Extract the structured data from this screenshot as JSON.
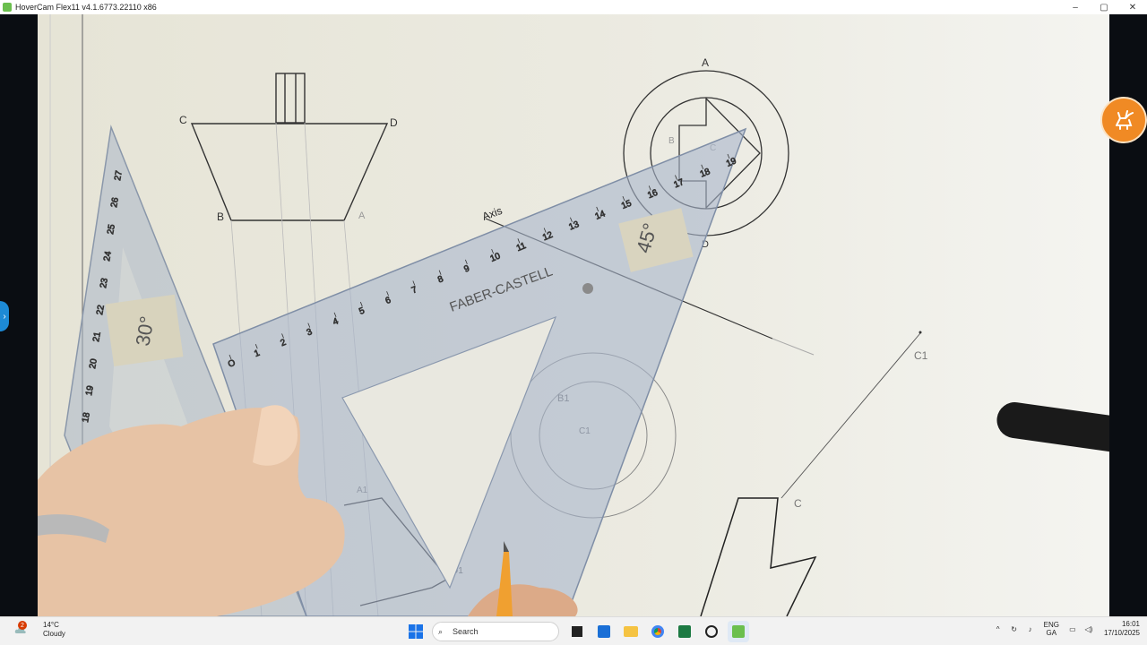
{
  "titlebar": {
    "title": "HoverCam Flex11 v4.1.6773.22110 x86",
    "minimize_glyph": "–",
    "maximize_glyph": "▢",
    "close_glyph": "✕"
  },
  "camera_feed": {
    "drawing_labels": {
      "c": "C",
      "d": "D",
      "b": "B",
      "a": "A",
      "axis": "Axis",
      "c1": "C1",
      "c_lower": "C",
      "b1": "B1",
      "c1_small": "C1",
      "top_a": "A",
      "b_small": "B",
      "c_small": "C",
      "d_small": "D",
      "a1": "A1",
      "d1": "D1"
    },
    "set_square_30": {
      "angle_label": "30°",
      "scale": [
        "27",
        "26",
        "25",
        "24",
        "23",
        "22",
        "21",
        "20",
        "19",
        "18"
      ]
    },
    "set_square_45": {
      "brand": "FABER-CASTELL",
      "angle_label": "45°",
      "scale": [
        "O",
        "1",
        "2",
        "3",
        "4",
        "5",
        "6",
        "7",
        "8",
        "9",
        "10",
        "11",
        "12",
        "13",
        "14",
        "15",
        "16",
        "17",
        "18",
        "19"
      ]
    }
  },
  "side_tab": {
    "glyph": "›"
  },
  "taskbar": {
    "weather": {
      "badge": "2",
      "temp": "14°C",
      "condition": "Cloudy"
    },
    "search_placeholder": "Search",
    "tray": {
      "chevron": "^",
      "lang_top": "ENG",
      "lang_bottom": "GA",
      "time": "16:01",
      "date": "17/10/2025"
    }
  }
}
